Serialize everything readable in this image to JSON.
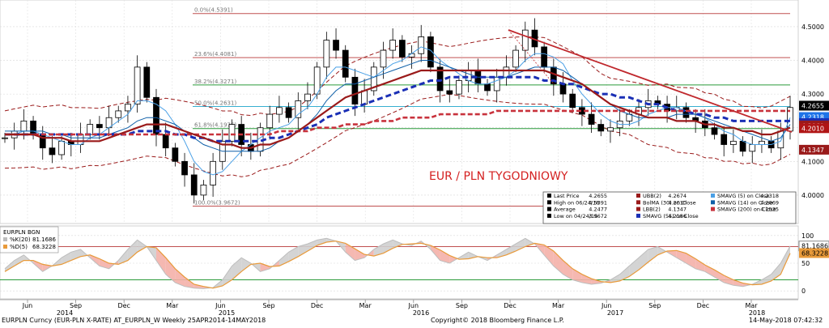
{
  "chart_data": [
    {
      "type": "candlestick",
      "title": "EUR / PLN TYGODNIOWY",
      "ylim": [
        3.93,
        4.56
      ],
      "yticks": [
        "4.0000",
        "4.1000",
        "4.2000",
        "4.3000",
        "4.4000",
        "4.5000"
      ],
      "grid": true,
      "fib_levels": [
        {
          "label": "0.0%(4.5391)",
          "value": 4.5391
        },
        {
          "label": "23.6%(4.4081)",
          "value": 4.4081
        },
        {
          "label": "38.2%(4.3271)",
          "value": 4.3271
        },
        {
          "label": "50.0%(4.2631)",
          "value": 4.2631
        },
        {
          "label": "61.8%(4.1976)",
          "value": 4.1976
        },
        {
          "label": "100.0%(3.9672)",
          "value": 3.9672
        }
      ],
      "price_tags": [
        {
          "label": "4.2655",
          "value": 4.2655,
          "color": "#000000"
        },
        {
          "label": "4.2318",
          "value": 4.2318,
          "color": "#1e73e8"
        },
        {
          "label": "4.2186",
          "value": 4.2186,
          "color": "#1a2fb5"
        },
        {
          "label": "4.2069",
          "value": 4.2069,
          "color": "#9a1a1a"
        },
        {
          "label": "4.2010",
          "value": 4.201,
          "color": "#b01515"
        },
        {
          "label": "4.1347",
          "value": 4.1347,
          "color": "#9a1a1a"
        }
      ],
      "series": [
        {
          "name": "Last Price",
          "values": [
            4.17,
            4.19,
            4.22,
            4.18,
            4.14,
            4.12,
            4.16,
            4.15,
            4.18,
            4.21,
            4.2,
            4.23,
            4.25,
            4.27,
            4.38,
            4.29,
            4.18,
            4.14,
            4.1,
            4.06,
            4.0,
            4.03,
            4.1,
            4.16,
            4.21,
            4.15,
            4.13,
            4.2,
            4.24,
            4.26,
            4.23,
            4.28,
            4.3,
            4.38,
            4.46,
            4.43,
            4.35,
            4.27,
            4.31,
            4.38,
            4.43,
            4.46,
            4.41,
            4.42,
            4.47,
            4.38,
            4.31,
            4.3,
            4.34,
            4.37,
            4.33,
            4.31,
            4.35,
            4.38,
            4.43,
            4.49,
            4.44,
            4.38,
            4.33,
            4.3,
            4.26,
            4.24,
            4.21,
            4.19,
            4.2,
            4.22,
            4.24,
            4.26,
            4.28,
            4.27,
            4.25,
            4.26,
            4.23,
            4.22,
            4.2,
            4.18,
            4.15,
            4.16,
            4.13,
            4.15,
            4.16,
            4.14,
            4.19,
            4.26
          ]
        },
        {
          "name": "SMAVG (5) on Close",
          "values": [
            4.18,
            4.18,
            4.19,
            4.19,
            4.18,
            4.17,
            4.16,
            4.15,
            4.15,
            4.17,
            4.18,
            4.2,
            4.22,
            4.24,
            4.28,
            4.28,
            4.27,
            4.25,
            4.21,
            4.16,
            4.1,
            4.07,
            4.06,
            4.07,
            4.1,
            4.13,
            4.15,
            4.17,
            4.19,
            4.2,
            4.21,
            4.24,
            4.26,
            4.3,
            4.35,
            4.38,
            4.38,
            4.37,
            4.36,
            4.35,
            4.37,
            4.39,
            4.4,
            4.42,
            4.44,
            4.43,
            4.4,
            4.38,
            4.36,
            4.34,
            4.33,
            4.33,
            4.34,
            4.35,
            4.37,
            4.4,
            4.42,
            4.42,
            4.41,
            4.39,
            4.34,
            4.3,
            4.27,
            4.24,
            4.22,
            4.21,
            4.21,
            4.22,
            4.24,
            4.25,
            4.26,
            4.26,
            4.25,
            4.24,
            4.23,
            4.21,
            4.19,
            4.18,
            4.16,
            4.15,
            4.15,
            4.15,
            4.16,
            4.23
          ]
        },
        {
          "name": "SMAVG (14) on Close",
          "values": [
            4.19,
            4.19,
            4.19,
            4.19,
            4.19,
            4.18,
            4.18,
            4.17,
            4.17,
            4.17,
            4.17,
            4.18,
            4.19,
            4.2,
            4.22,
            4.23,
            4.23,
            4.22,
            4.21,
            4.19,
            4.17,
            4.15,
            4.14,
            4.13,
            4.13,
            4.13,
            4.13,
            4.13,
            4.14,
            4.16,
            4.17,
            4.19,
            4.21,
            4.24,
            4.28,
            4.31,
            4.33,
            4.33,
            4.34,
            4.35,
            4.36,
            4.37,
            4.38,
            4.39,
            4.4,
            4.4,
            4.39,
            4.38,
            4.37,
            4.36,
            4.35,
            4.35,
            4.35,
            4.35,
            4.36,
            4.37,
            4.38,
            4.38,
            4.38,
            4.37,
            4.35,
            4.33,
            4.31,
            4.29,
            4.27,
            4.25,
            4.24,
            4.23,
            4.23,
            4.23,
            4.23,
            4.24,
            4.24,
            4.24,
            4.23,
            4.22,
            4.21,
            4.2,
            4.19,
            4.18,
            4.17,
            4.16,
            4.17,
            4.21
          ]
        },
        {
          "name": "SMAVG (55) on Close",
          "values": [
            4.18,
            4.18,
            4.18,
            4.18,
            4.18,
            4.18,
            4.18,
            4.18,
            4.18,
            4.18,
            4.18,
            4.18,
            4.18,
            4.18,
            4.19,
            4.19,
            4.19,
            4.19,
            4.18,
            4.18,
            4.17,
            4.17,
            4.16,
            4.16,
            4.16,
            4.16,
            4.16,
            4.16,
            4.17,
            4.17,
            4.18,
            4.19,
            4.2,
            4.21,
            4.23,
            4.24,
            4.25,
            4.26,
            4.27,
            4.28,
            4.29,
            4.3,
            4.31,
            4.32,
            4.33,
            4.34,
            4.34,
            4.35,
            4.35,
            4.35,
            4.35,
            4.35,
            4.35,
            4.35,
            4.35,
            4.35,
            4.35,
            4.34,
            4.34,
            4.33,
            4.33,
            4.32,
            4.31,
            4.3,
            4.3,
            4.29,
            4.29,
            4.28,
            4.27,
            4.27,
            4.26,
            4.25,
            4.25,
            4.24,
            4.24,
            4.23,
            4.23,
            4.22,
            4.22,
            4.22,
            4.22,
            4.22,
            4.22,
            4.22
          ]
        },
        {
          "name": "SMAVG (200) on Close",
          "values": [
            4.18,
            4.18,
            4.18,
            4.18,
            4.18,
            4.18,
            4.18,
            4.18,
            4.18,
            4.18,
            4.18,
            4.18,
            4.18,
            4.18,
            4.18,
            4.18,
            4.18,
            4.18,
            4.18,
            4.18,
            4.18,
            4.18,
            4.18,
            4.18,
            4.18,
            4.18,
            4.18,
            4.18,
            4.18,
            4.19,
            4.19,
            4.19,
            4.19,
            4.2,
            4.2,
            4.2,
            4.21,
            4.21,
            4.21,
            4.22,
            4.22,
            4.22,
            4.23,
            4.23,
            4.23,
            4.23,
            4.24,
            4.24,
            4.24,
            4.24,
            4.24,
            4.24,
            4.25,
            4.25,
            4.25,
            4.25,
            4.25,
            4.25,
            4.25,
            4.25,
            4.25,
            4.25,
            4.25,
            4.25,
            4.25,
            4.25,
            4.25,
            4.25,
            4.25,
            4.25,
            4.25,
            4.25,
            4.25,
            4.25,
            4.25,
            4.25,
            4.25,
            4.25,
            4.25,
            4.25,
            4.25,
            4.25,
            4.25,
            4.25
          ]
        },
        {
          "name": "BolMA (30) on Close",
          "values": [
            4.18,
            4.18,
            4.18,
            4.18,
            4.17,
            4.17,
            4.17,
            4.16,
            4.16,
            4.16,
            4.16,
            4.17,
            4.18,
            4.19,
            4.2,
            4.21,
            4.21,
            4.21,
            4.2,
            4.19,
            4.18,
            4.17,
            4.16,
            4.15,
            4.15,
            4.14,
            4.14,
            4.15,
            4.15,
            4.16,
            4.17,
            4.19,
            4.21,
            4.23,
            4.25,
            4.27,
            4.29,
            4.3,
            4.31,
            4.32,
            4.33,
            4.34,
            4.35,
            4.36,
            4.37,
            4.37,
            4.37,
            4.37,
            4.37,
            4.37,
            4.37,
            4.37,
            4.37,
            4.37,
            4.37,
            4.37,
            4.37,
            4.37,
            4.36,
            4.35,
            4.34,
            4.33,
            4.31,
            4.29,
            4.27,
            4.26,
            4.25,
            4.24,
            4.23,
            4.23,
            4.23,
            4.22,
            4.22,
            4.22,
            4.21,
            4.21,
            4.2,
            4.2,
            4.19,
            4.19,
            4.18,
            4.18,
            4.19,
            4.2
          ]
        }
      ],
      "legend": {
        "placement": "bottom-right",
        "entries": [
          [
            "Last Price",
            "4.2655"
          ],
          [
            "High on 06/24/16",
            "4.5391"
          ],
          [
            "Average",
            "4.2477"
          ],
          [
            "Low on 04/24/15",
            "3.9672"
          ],
          [
            "UBB(2)",
            "4.2674"
          ],
          [
            "BolMA (30) on Close",
            "4.2010"
          ],
          [
            "LBB(2)",
            "4.1347"
          ],
          [
            "SMAVG (55) on Close",
            "4.2186"
          ],
          [
            "SMAVG (5) on Close",
            "4.2318"
          ],
          [
            "SMAVG (14) on Close",
            "4.2069"
          ],
          [
            "SMAVG (200) on Close",
            "4.2535"
          ]
        ]
      }
    },
    {
      "type": "line",
      "title": "EURPLN BGN",
      "ylim": [
        -10,
        110
      ],
      "yticks": [
        "0",
        "50",
        "100"
      ],
      "series": [
        {
          "name": "%K(20)",
          "last": "81.1686",
          "values": [
            40,
            55,
            65,
            50,
            35,
            45,
            60,
            70,
            75,
            60,
            45,
            40,
            55,
            75,
            92,
            80,
            55,
            30,
            15,
            8,
            5,
            4,
            6,
            20,
            45,
            60,
            50,
            35,
            40,
            55,
            70,
            80,
            85,
            92,
            95,
            90,
            70,
            55,
            60,
            75,
            85,
            92,
            85,
            82,
            90,
            75,
            55,
            50,
            60,
            70,
            62,
            55,
            65,
            75,
            85,
            95,
            85,
            65,
            45,
            30,
            20,
            15,
            12,
            14,
            20,
            30,
            45,
            60,
            75,
            80,
            70,
            60,
            50,
            40,
            35,
            25,
            15,
            10,
            8,
            12,
            20,
            30,
            50,
            81
          ]
        },
        {
          "name": "%D(5)",
          "last": "68.3228",
          "values": [
            35,
            45,
            55,
            55,
            48,
            45,
            48,
            55,
            62,
            65,
            58,
            50,
            48,
            55,
            70,
            80,
            78,
            60,
            40,
            25,
            12,
            8,
            5,
            9,
            20,
            35,
            48,
            50,
            44,
            45,
            53,
            62,
            72,
            82,
            88,
            90,
            86,
            76,
            66,
            63,
            68,
            77,
            84,
            85,
            86,
            82,
            74,
            64,
            57,
            58,
            62,
            60,
            60,
            65,
            72,
            80,
            86,
            83,
            72,
            55,
            40,
            30,
            22,
            17,
            15,
            18,
            26,
            38,
            52,
            65,
            72,
            73,
            68,
            58,
            47,
            38,
            28,
            20,
            14,
            11,
            12,
            18,
            30,
            68
          ]
        }
      ]
    }
  ],
  "time_axis": {
    "months": [
      "Jun",
      "Sep",
      "Dec",
      "Mar",
      "Jun",
      "Sep",
      "Dec",
      "Mar",
      "Jun",
      "Sep",
      "Dec",
      "Mar",
      "Jun",
      "Sep",
      "Dec",
      "Mar"
    ],
    "years": [
      "2014",
      "2015",
      "2016",
      "2017",
      "2018"
    ]
  },
  "footer": {
    "left": "EURPLN Curncy (EUR-PLN X-RATE) AT_EURPLN_W  Weekly 25APR2014-14MAY2018",
    "center": "Copyright© 2018 Bloomberg Finance L.P.",
    "right": "14-May-2018 07:42:32"
  },
  "colors": {
    "bollinger": "#9a1a1a",
    "smavg5": "#4aa0e6",
    "smavg14": "#0e5fa8",
    "smavg55": "#1a2fb5",
    "smavg200": "#c8323c",
    "bolma": "#9a1a1a",
    "trend": "#c0282d",
    "fib_red": "#c05050",
    "fib_green": "#2a9a3a",
    "fib_cyan": "#38b0d0",
    "k_line": "#bdbdbd",
    "d_line": "#e89a3a"
  }
}
